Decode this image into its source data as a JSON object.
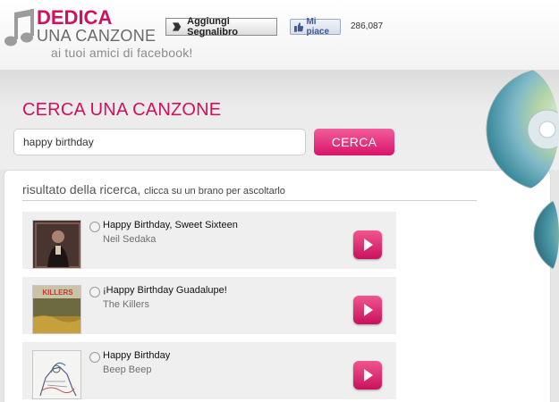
{
  "header": {
    "logo_top": "DEDICA",
    "logo_bottom": "UNA CANZONE",
    "tagline": "ai tuoi amici di facebook!",
    "bookmark_label": "Aggiungi Segnalibro",
    "like_label": "Mi piace",
    "like_count": "286,087"
  },
  "search": {
    "title": "CERCA UNA CANZONE",
    "query": "happy birthday",
    "button_label": "CERCA"
  },
  "results": {
    "heading": "risultato della ricerca,",
    "hint": "clicca su un brano per ascoltarlo",
    "items": [
      {
        "title": "Happy Birthday, Sweet Sixteen",
        "artist": "Neil Sedaka"
      },
      {
        "title": "¡Happy Birthday Guadalupe!",
        "artist": "The Killers"
      },
      {
        "title": "Happy Birthday",
        "artist": "Beep Beep"
      }
    ]
  },
  "colors": {
    "accent": "#d3105f",
    "button": "#e3206f"
  }
}
